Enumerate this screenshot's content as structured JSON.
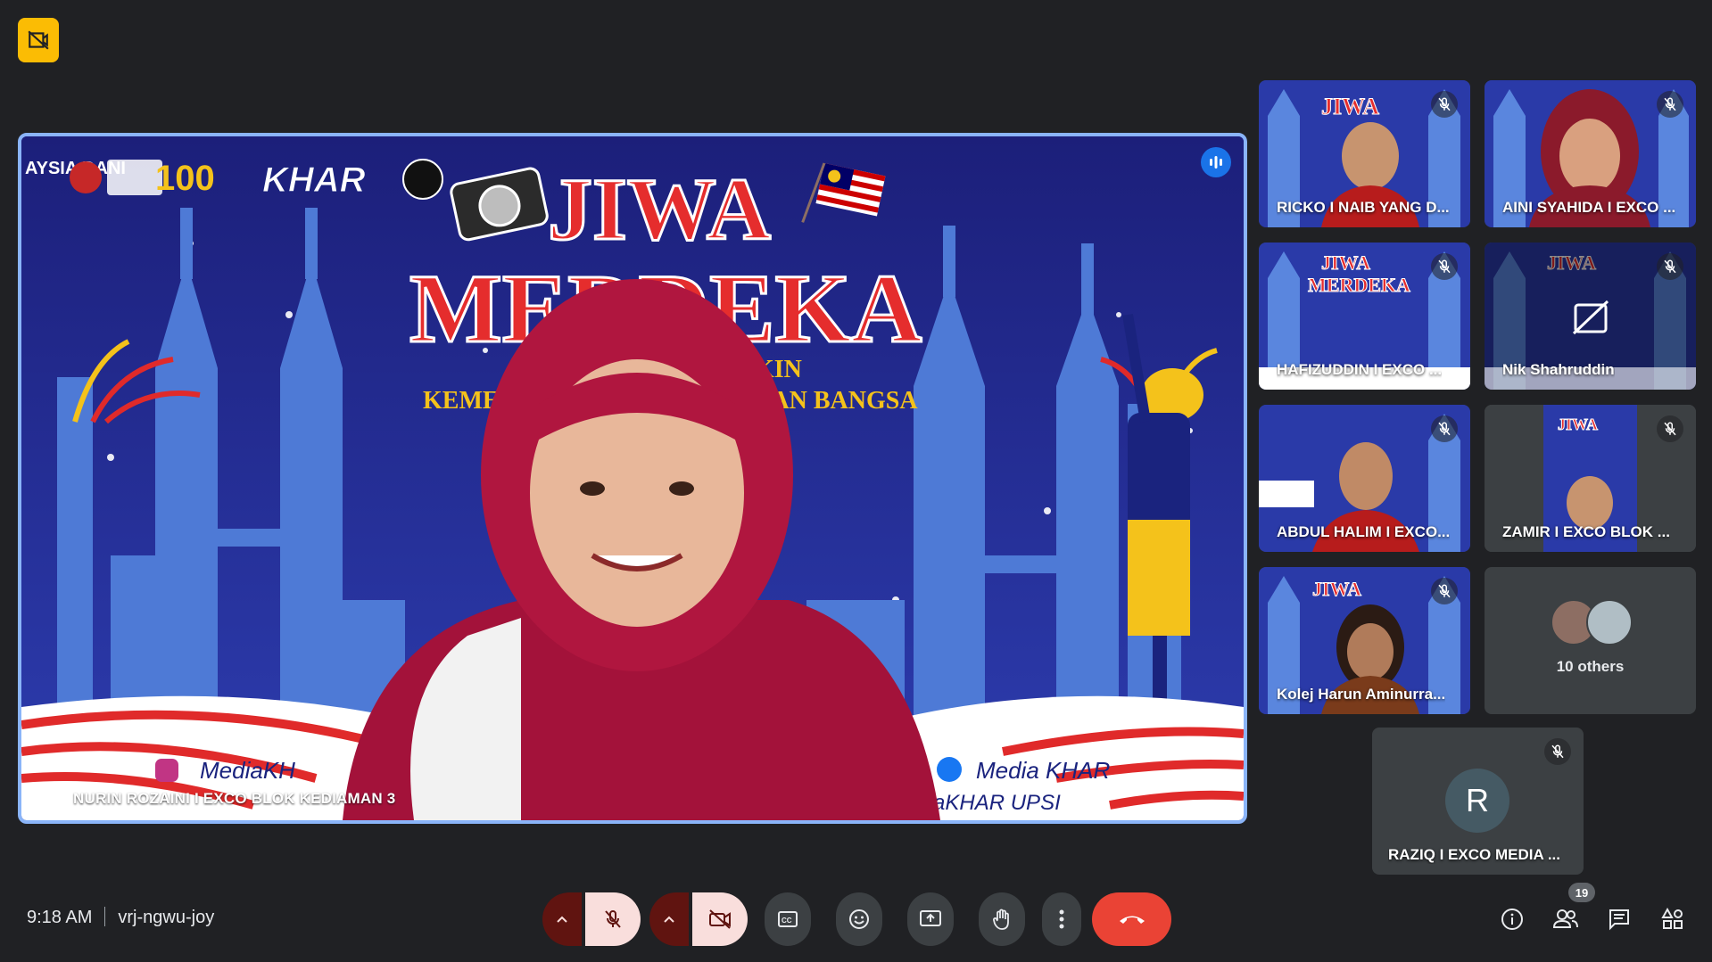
{
  "meeting": {
    "time": "9:18 AM",
    "code": "vrj-ngwu-joy"
  },
  "main": {
    "name": "NURIN ROZAINI I EXCO BLOK KEDIAMAN 3",
    "banner_title_1": "JIWA",
    "banner_title_2": "MERDEKA",
    "banner_sub_left": "KEMEI",
    "banner_sub_right": "DUAN BANGSA",
    "banner_sub_top": "NGKIN",
    "logo_text": "KHAR",
    "badge_100": "100",
    "corner_text": "AYSIA DANI",
    "social_left": "MediaKH",
    "social_right_1": "Media KHAR",
    "social_right_2": "ediaKHAR UPSI"
  },
  "participants": [
    {
      "name": "RICKO I NAIB YANG D...",
      "muted": true,
      "video": true
    },
    {
      "name": "AINI SYAHIDA I EXCO ...",
      "muted": true,
      "video": true
    },
    {
      "name": "HAFIZUDDIN I EXCO ...",
      "muted": true,
      "video": true
    },
    {
      "name": "Nik Shahruddin",
      "muted": true,
      "video": false
    },
    {
      "name": "ABDUL HALIM I EXCO...",
      "muted": true,
      "video": true
    },
    {
      "name": "ZAMIR I EXCO BLOK ...",
      "muted": true,
      "video": true
    },
    {
      "name": "Kolej Harun Aminurra...",
      "muted": true,
      "video": true
    }
  ],
  "others": {
    "label": "10 others"
  },
  "self_tile": {
    "initial": "R",
    "name": "RAZIQ I EXCO MEDIA ...",
    "muted": true
  },
  "people_count": "19",
  "icons": {
    "top_left": "camera-off-square-icon",
    "controls": [
      "chevron-up-icon",
      "mic-off-icon",
      "chevron-up-icon",
      "camera-off-icon",
      "captions-icon",
      "emoji-icon",
      "present-icon",
      "raise-hand-icon",
      "more-vert-icon",
      "end-call-icon"
    ],
    "right": [
      "info-icon",
      "people-icon",
      "chat-icon",
      "activities-icon"
    ]
  },
  "colors": {
    "accent": "#8ab4f8",
    "end_call": "#ea4335",
    "badge": "#fbbc04",
    "active_speaker": "#1a73e8"
  }
}
